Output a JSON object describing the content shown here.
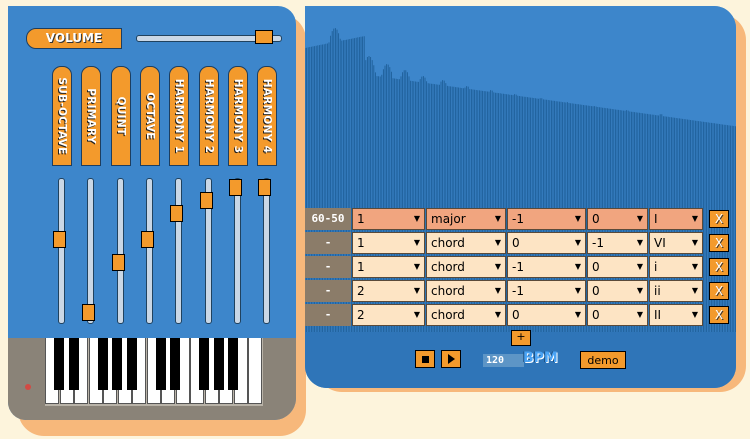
{
  "colors": {
    "panel_blue": "#3d86cb",
    "accent_orange": "#f39a2c",
    "shadow_peach": "#f7b87b",
    "row_active": "#f1a57f",
    "row_normal": "#fde4c4"
  },
  "volume": {
    "label": "VOLUME",
    "level": 0.92
  },
  "channels": [
    {
      "label": "SUB-OCTAVE",
      "level": 0.6
    },
    {
      "label": "PRIMARY",
      "level": 0.03
    },
    {
      "label": "QUINT",
      "level": 0.42
    },
    {
      "label": "OCTAVE",
      "level": 0.6
    },
    {
      "label": "HARMONY 1",
      "level": 0.8
    },
    {
      "label": "HARMONY 2",
      "level": 0.9
    },
    {
      "label": "HARMONY 3",
      "level": 1.0
    },
    {
      "label": "HARMONY 4",
      "level": 1.0
    }
  ],
  "sequence": {
    "rows": [
      {
        "tag": "60-50",
        "active": true,
        "c1": "1",
        "c2": "major",
        "c3": "-1",
        "c4": "0",
        "c5": "I",
        "delete": "X"
      },
      {
        "tag": "-",
        "active": false,
        "c1": "1",
        "c2": "chord",
        "c3": "0",
        "c4": "-1",
        "c5": "VI",
        "delete": "X"
      },
      {
        "tag": "-",
        "active": false,
        "c1": "1",
        "c2": "chord",
        "c3": "-1",
        "c4": "0",
        "c5": "i",
        "delete": "X"
      },
      {
        "tag": "-",
        "active": false,
        "c1": "2",
        "c2": "chord",
        "c3": "-1",
        "c4": "0",
        "c5": "ii",
        "delete": "X"
      },
      {
        "tag": "-",
        "active": false,
        "c1": "2",
        "c2": "chord",
        "c3": "0",
        "c4": "0",
        "c5": "II",
        "delete": "X"
      }
    ],
    "add_label": "+"
  },
  "transport": {
    "stop_icon": "stop-icon",
    "play_icon": "play-icon",
    "bpm_value": "120",
    "bpm_label": "BPM",
    "demo_label": "demo"
  }
}
